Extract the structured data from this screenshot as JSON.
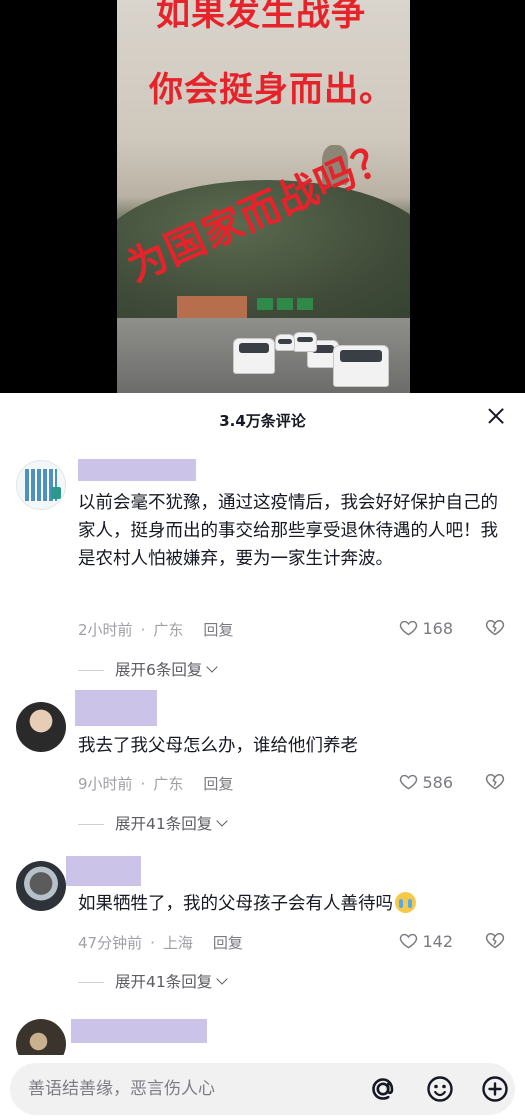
{
  "video": {
    "overlay_line1": "如果发生战争",
    "overlay_line2": "你会挺身而出。",
    "overlay_line3": "为国家而战吗？"
  },
  "comments_panel": {
    "title": "3.4万条评论",
    "close_icon": "close-icon"
  },
  "comments": [
    {
      "text": "以前会毫不犹豫，通过这疫情后，我会好好保护自己的家人，挺身而出的事交给那些享受退休待遇的人吧！我是农村人怕被嫌弃，要为一家生计奔波。",
      "time": "2小时前",
      "location": "广东",
      "reply_label": "回复",
      "likes": "168",
      "expand_label": "展开6条回复"
    },
    {
      "text": "我去了我父母怎么办，谁给他们养老",
      "time": "9小时前",
      "location": "广东",
      "reply_label": "回复",
      "likes": "586",
      "expand_label": "展开41条回复"
    },
    {
      "text": "如果牺牲了，我的父母孩子会有人善待吗",
      "time": "47分钟前",
      "location": "上海",
      "reply_label": "回复",
      "likes": "142",
      "expand_label": "展开41条回复"
    }
  ],
  "input": {
    "placeholder": "善语结善缘，恶言伤人心",
    "icons": [
      "at-icon",
      "emoji-icon",
      "add-icon"
    ]
  },
  "colors": {
    "accent_red": "#e6232a",
    "username_placeholder": "#cbc4e8",
    "muted_text": "#a0a0a5"
  }
}
